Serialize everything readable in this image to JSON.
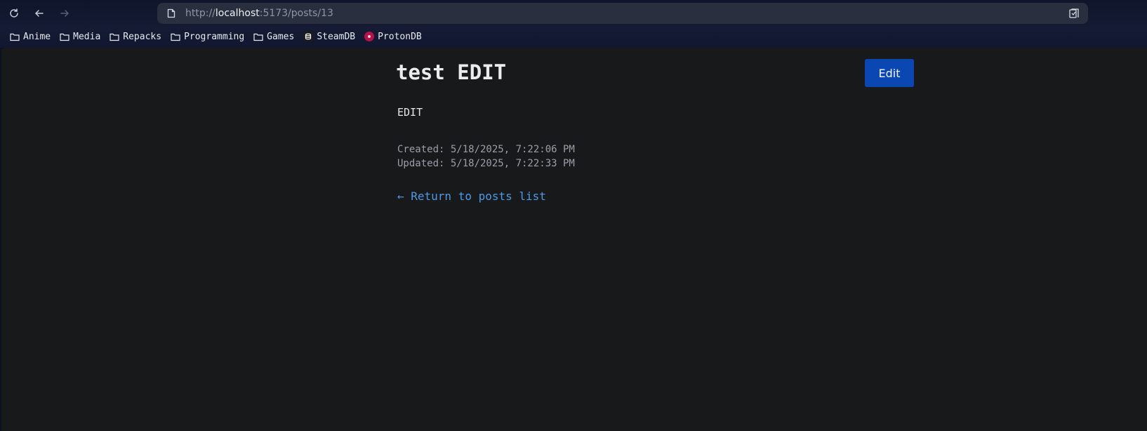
{
  "browser": {
    "url_scheme": "http://",
    "url_host": "localhost",
    "url_rest": ":5173/posts/13",
    "bookmarks": [
      {
        "label": "Anime",
        "icon": "folder-icon"
      },
      {
        "label": "Media",
        "icon": "folder-icon"
      },
      {
        "label": "Repacks",
        "icon": "folder-icon"
      },
      {
        "label": "Programming",
        "icon": "folder-icon"
      },
      {
        "label": "Games",
        "icon": "folder-icon"
      },
      {
        "label": "SteamDB",
        "icon": "steamdb-favicon"
      },
      {
        "label": "ProtonDB",
        "icon": "protondb-favicon"
      }
    ]
  },
  "post": {
    "title": "test EDIT",
    "body": "EDIT",
    "created": "Created: 5/18/2025, 7:22:06 PM",
    "updated": "Updated: 5/18/2025, 7:22:33 PM",
    "edit_label": "Edit",
    "back_label": "← Return to posts list"
  },
  "colors": {
    "accent_button": "#0b47b3",
    "link": "#4c9ae6",
    "page_background": "#18191b"
  }
}
